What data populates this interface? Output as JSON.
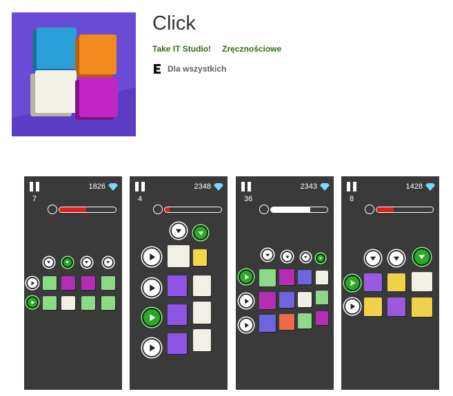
{
  "app": {
    "title": "Click",
    "developer": "Take IT Studio!",
    "category": "Zręcznościowe",
    "rating_label": "Dla wszystkich",
    "rating_icon": "esrb-e-icon"
  },
  "colors": {
    "developer_green": "#33691e",
    "icon_background": "#6a4bd6",
    "screenshot_background": "#3a3a3a",
    "timer_red": "#e02020",
    "green_button": "#2aa82a"
  },
  "screenshots": [
    {
      "score": "1826",
      "level": "7",
      "timer_fraction": 0.48,
      "timer_color": "#e02020"
    },
    {
      "score": "2348",
      "level": "4",
      "timer_fraction": 0.08,
      "timer_color": "#e02020"
    },
    {
      "score": "2343",
      "level": "36",
      "timer_fraction": 0.7,
      "timer_color": "#ffffff"
    },
    {
      "score": "1428",
      "level": "8",
      "timer_fraction": 0.3,
      "timer_color": "#e02020"
    }
  ]
}
